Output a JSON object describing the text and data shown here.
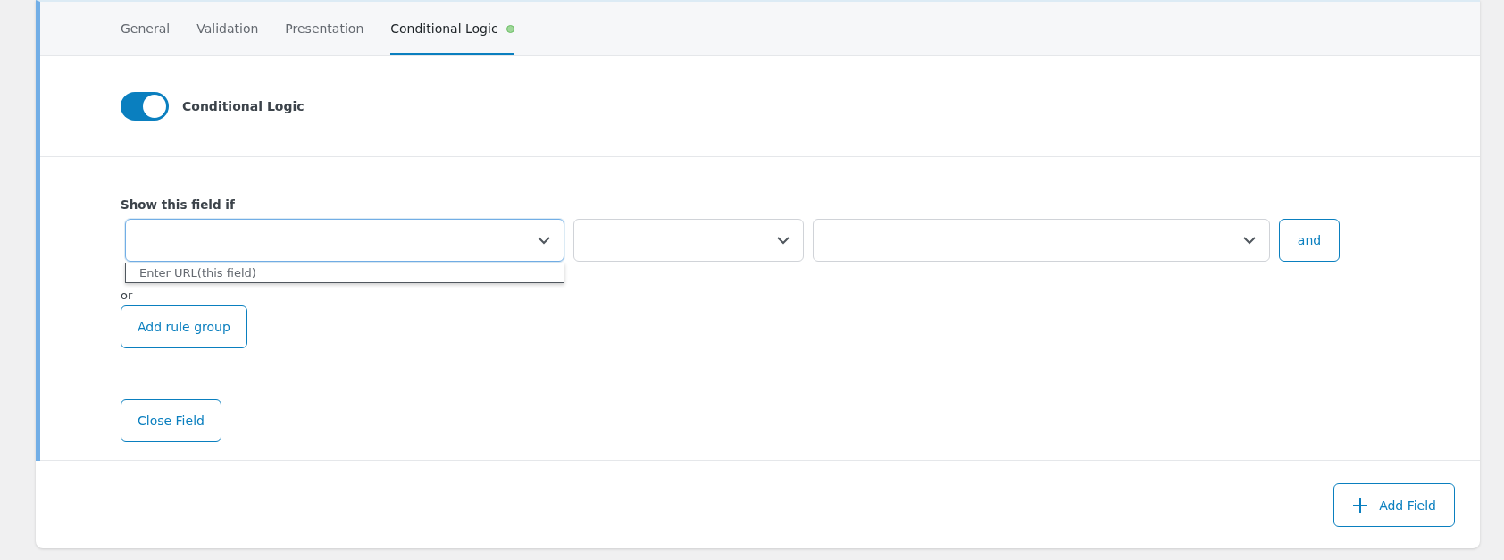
{
  "tabs": [
    {
      "label": "General",
      "selected": false,
      "indicator": false
    },
    {
      "label": "Validation",
      "selected": false,
      "indicator": false
    },
    {
      "label": "Presentation",
      "selected": false,
      "indicator": false
    },
    {
      "label": "Conditional Logic",
      "selected": true,
      "indicator": true
    }
  ],
  "toggle": {
    "label": "Conditional Logic",
    "on": true
  },
  "rules": {
    "heading": "Show this field if",
    "selects": [
      {
        "open": true,
        "options": [
          "Enter URL(this field)"
        ]
      },
      {
        "open": false
      },
      {
        "open": false
      }
    ],
    "and_button": "and",
    "or_label": "or",
    "add_group_button": "Add rule group"
  },
  "close_button": "Close Field",
  "add_field_button": "Add Field"
}
